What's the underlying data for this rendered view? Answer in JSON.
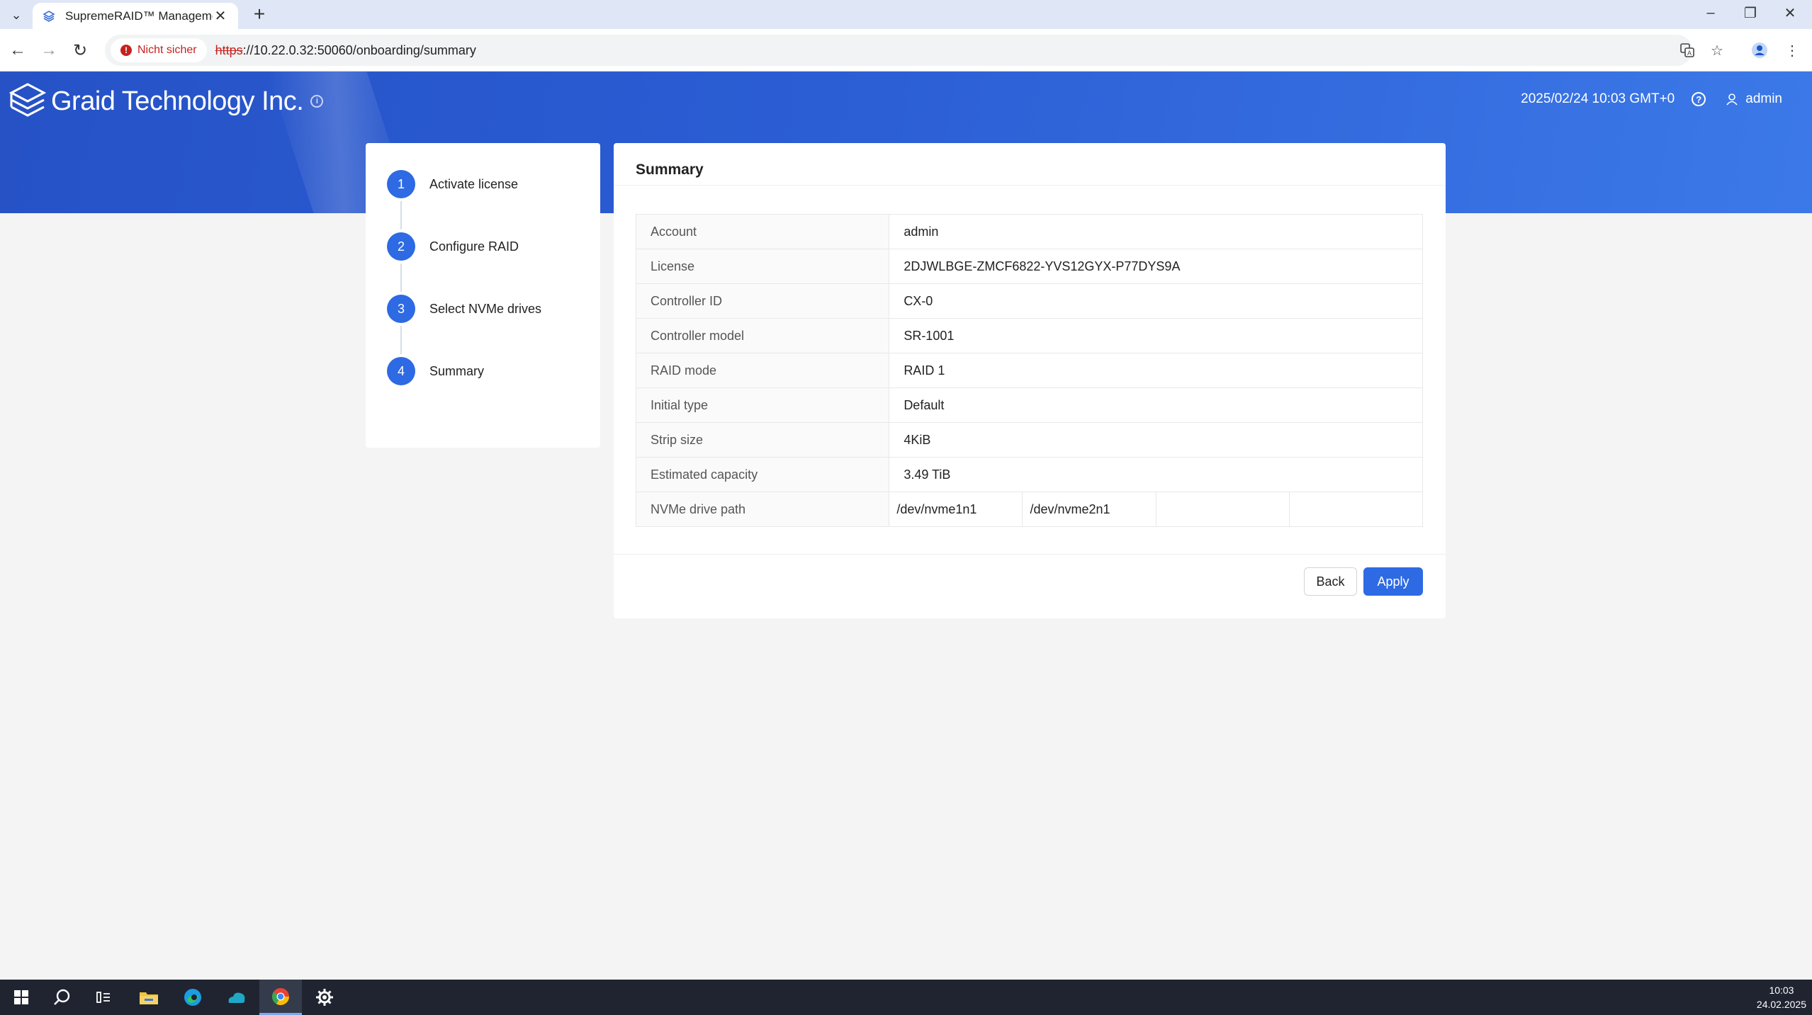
{
  "browser": {
    "tab_title": "SupremeRAID™ Management C",
    "security_label": "Nicht sicher",
    "url_scheme": "https",
    "url_rest": "://10.22.0.32:50060/onboarding/summary"
  },
  "header": {
    "company": "Graid Technology Inc.",
    "datetime": "2025/02/24 10:03 GMT+0",
    "user": "admin"
  },
  "steps": [
    {
      "num": "1",
      "label": "Activate license"
    },
    {
      "num": "2",
      "label": "Configure RAID"
    },
    {
      "num": "3",
      "label": "Select NVMe drives"
    },
    {
      "num": "4",
      "label": "Summary"
    }
  ],
  "summary": {
    "title": "Summary",
    "rows": [
      {
        "key": "Account",
        "value": "admin"
      },
      {
        "key": "License",
        "value": "2DJWLBGE-ZMCF6822-YVS12GYX-P77DYS9A"
      },
      {
        "key": "Controller ID",
        "value": "CX-0"
      },
      {
        "key": "Controller model",
        "value": "SR-1001"
      },
      {
        "key": "RAID mode",
        "value": "RAID 1"
      },
      {
        "key": "Initial type",
        "value": "Default"
      },
      {
        "key": "Strip size",
        "value": "4KiB"
      },
      {
        "key": "Estimated capacity",
        "value": "3.49 TiB"
      }
    ],
    "drive_path_label": "NVMe drive path",
    "drive_paths": [
      "/dev/nvme1n1",
      "/dev/nvme2n1",
      "",
      ""
    ],
    "back_label": "Back",
    "apply_label": "Apply"
  },
  "taskbar": {
    "time": "10:03",
    "date": "24.02.2025"
  },
  "colors": {
    "accent": "#2d6ae3",
    "banner": "#2b5dd4"
  }
}
